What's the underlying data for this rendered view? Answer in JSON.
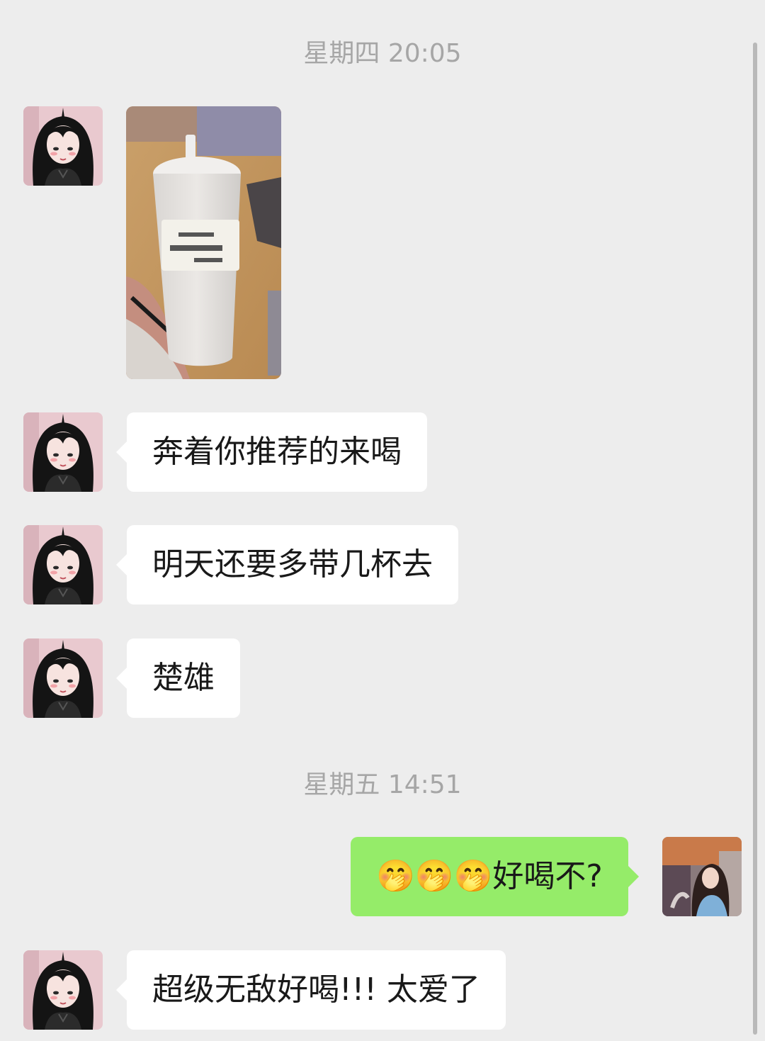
{
  "chat": {
    "timestamp_1": "星期四 20:05",
    "timestamp_2": "星期五 14:51",
    "messages": [
      {
        "text": "奔着你推荐的来喝"
      },
      {
        "text": "明天还要多带几杯去"
      },
      {
        "text": "楚雄"
      },
      {
        "emoji": "🤭🤭🤭",
        "text": "好喝不?"
      },
      {
        "text": "超级无敌好喝!!! 太爱了"
      }
    ]
  },
  "colors": {
    "background": "#ededed",
    "incoming_bubble": "#ffffff",
    "outgoing_bubble": "#95ec69",
    "timestamp_text": "#a6a6a6"
  },
  "icons": {
    "contact_avatar": "cartoon-girl-avatar",
    "self_avatar": "photo-avatar",
    "photo_message": "milk-tea-cup-photo"
  }
}
